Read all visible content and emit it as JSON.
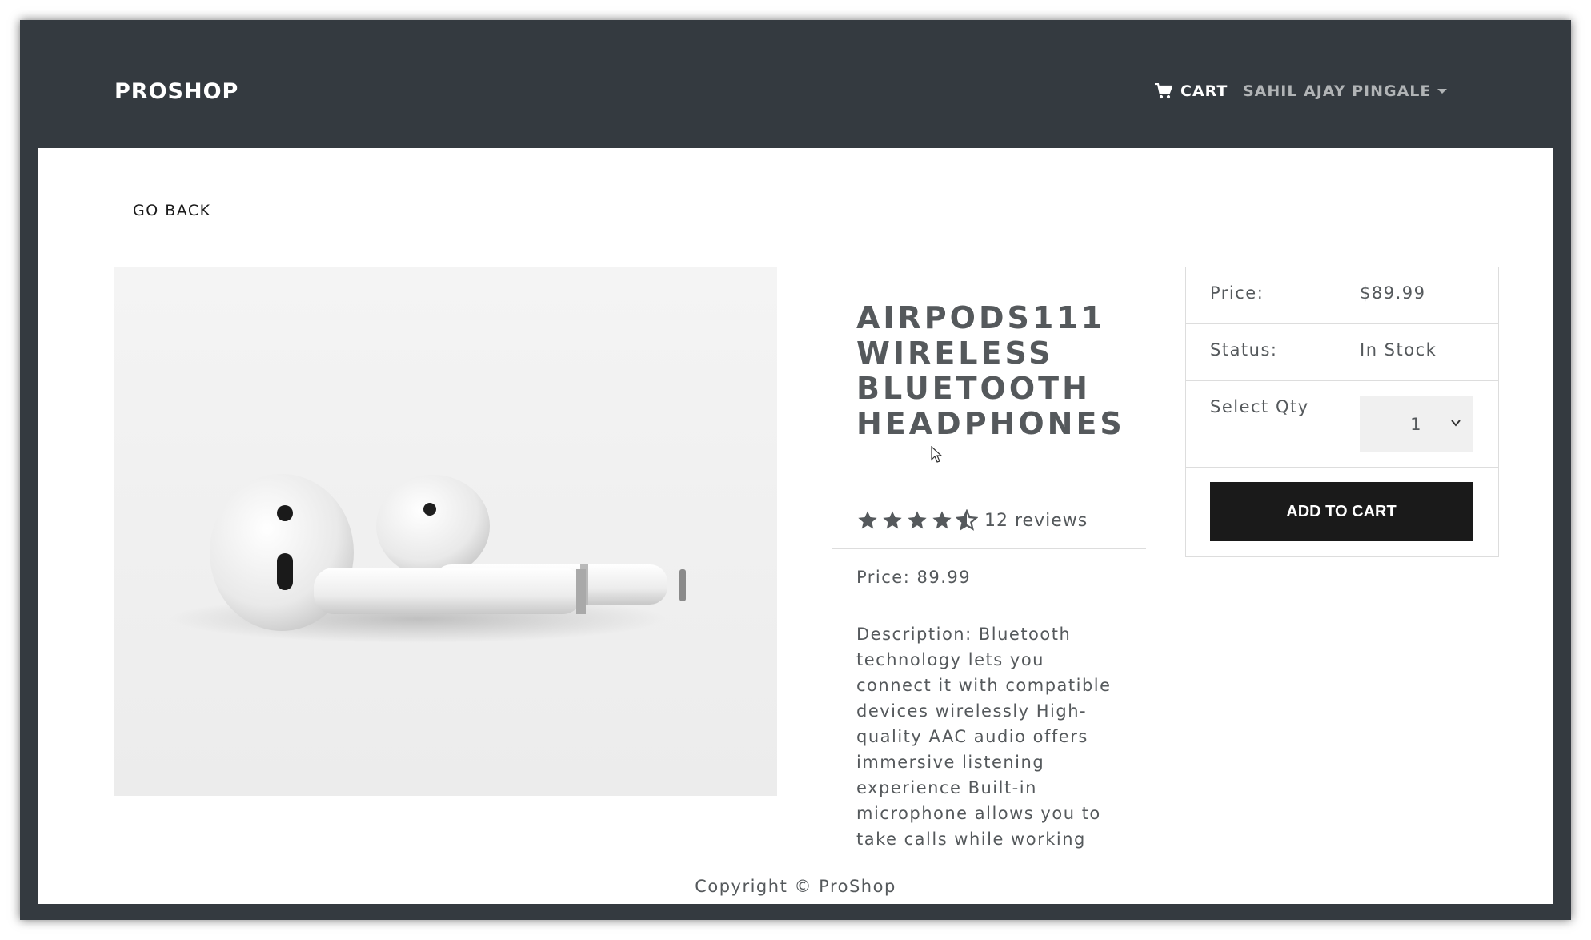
{
  "navbar": {
    "brand": "PROSHOP",
    "cart_label": "CART",
    "user_label": "SAHIL AJAY PINGALE"
  },
  "go_back_label": "GO BACK",
  "product": {
    "title": "AIRPODS111 WIRELESS BLUETOOTH HEADPHONES",
    "rating": 4.5,
    "reviews_text": "12 reviews",
    "price_text": "Price: 89.99",
    "description": "Description: Bluetooth technology lets you connect it with compatible devices wirelessly High-quality AAC audio offers immersive listening experience Built-in microphone allows you to take calls while working",
    "image_icon": "airpods-photo"
  },
  "purchase_card": {
    "price_label": "Price:",
    "price_value": "$89.99",
    "status_label": "Status:",
    "status_value": "In Stock",
    "qty_label": "Select Qty",
    "qty_value": "1",
    "add_to_cart_label": "ADD TO CART"
  },
  "footer": {
    "copyright": "Copyright © ProShop"
  },
  "colors": {
    "navbar_bg": "#343a40",
    "button_bg": "#1a1a1a",
    "text": "#55595c"
  }
}
